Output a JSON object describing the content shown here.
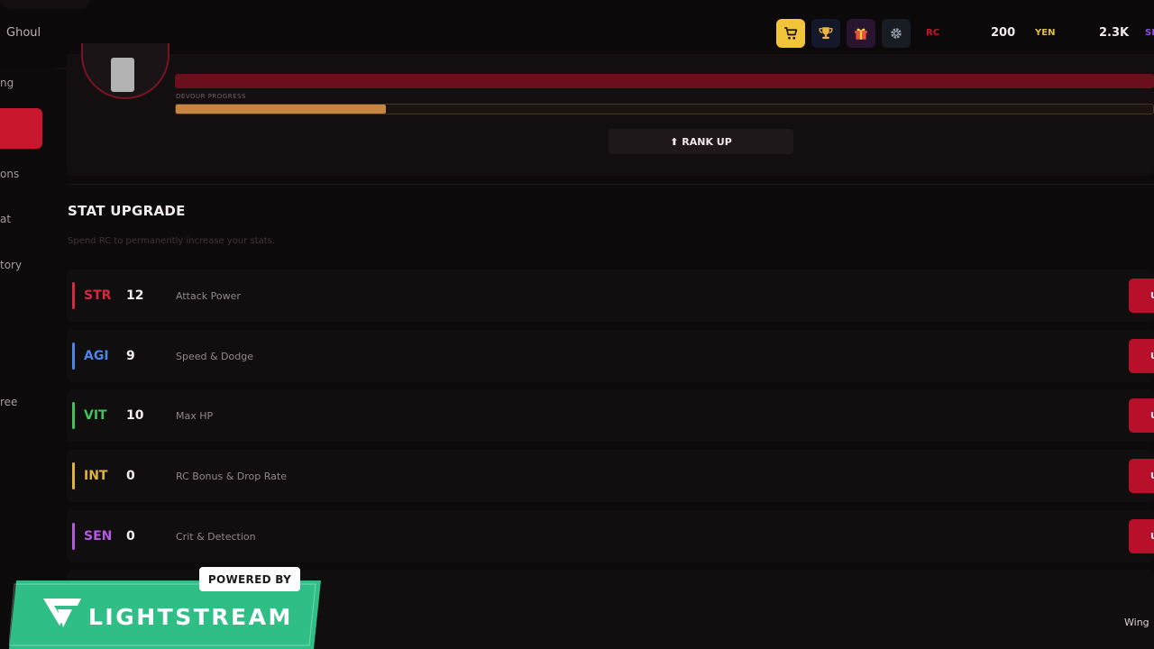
{
  "header": {
    "title": "Ghoul",
    "icons": [
      "shop-cart-icon",
      "trophy-icon",
      "gift-icon",
      "settings-gear-icon"
    ],
    "currencies": [
      {
        "label": "RC",
        "value": "200",
        "color": "#c8162c"
      },
      {
        "label": "YEN",
        "value": "2.3K",
        "color": "#e2c13a"
      },
      {
        "label": "SP",
        "value": "",
        "color": "#8a4ce0"
      }
    ]
  },
  "sidebar": {
    "items": [
      {
        "label": "ng"
      },
      {
        "label": ""
      },
      {
        "label": "ons"
      },
      {
        "label": "at"
      },
      {
        "label": "tory"
      },
      {
        "label": "ree"
      }
    ]
  },
  "profile": {
    "devour_label": "DEVOUR PROGRESS",
    "devour_progress": 0.215,
    "rank_up_label": "⬆ RANK UP"
  },
  "stat_upgrade": {
    "title": "STAT UPGRADE",
    "subtitle": "Spend RC to permanently increase your stats.",
    "stats": [
      {
        "code": "STR",
        "value": "12",
        "desc": "Attack Power",
        "color": "#d8283f",
        "button": "U"
      },
      {
        "code": "AGI",
        "value": "9",
        "desc": "Speed & Dodge",
        "color": "#4a86e8",
        "button": "U"
      },
      {
        "code": "VIT",
        "value": "10",
        "desc": "Max HP",
        "color": "#3ec45a",
        "button": "U"
      },
      {
        "code": "INT",
        "value": "0",
        "desc": "RC Bonus & Drop Rate",
        "color": "#e0b33a",
        "button": "U"
      },
      {
        "code": "SEN",
        "value": "0",
        "desc": "Crit & Detection",
        "color": "#b45ae0",
        "button": "U"
      }
    ]
  },
  "footer": {
    "wing_label": "Wing"
  },
  "overlay": {
    "powered_by": "POWERED BY",
    "brand": "LIGHTSTREAM",
    "brand_color": "#2fbf86"
  }
}
